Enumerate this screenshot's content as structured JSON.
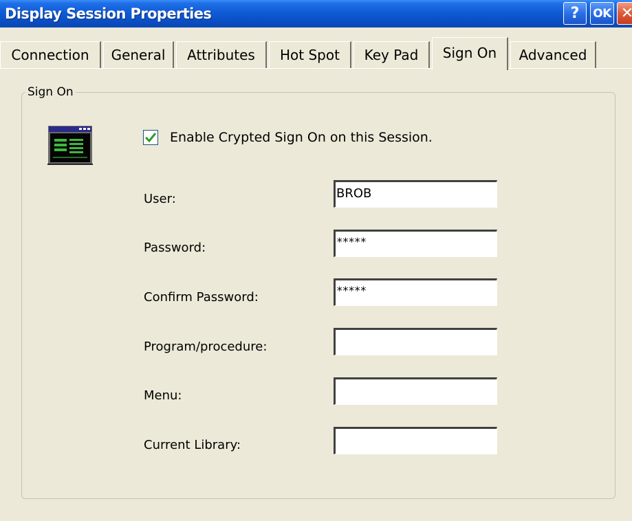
{
  "window": {
    "title": "Display Session Properties",
    "help_label": "?",
    "ok_label": "OK",
    "close_label": "✕"
  },
  "tabs": [
    {
      "label": "Connection",
      "active": false
    },
    {
      "label": "General",
      "active": false
    },
    {
      "label": "Attributes",
      "active": false
    },
    {
      "label": "Hot Spot",
      "active": false
    },
    {
      "label": "Key Pad",
      "active": false
    },
    {
      "label": "Sign On",
      "active": true
    },
    {
      "label": "Advanced",
      "active": false
    }
  ],
  "group": {
    "legend": "Sign On",
    "icon": "terminal-session-icon"
  },
  "enable_signon": {
    "label": "Enable Crypted Sign On on this Session.",
    "checked": true
  },
  "fields": {
    "user": {
      "label": "User:",
      "value": "BROB"
    },
    "password": {
      "label": "Password:",
      "value": "*****"
    },
    "confirm_password": {
      "label": "Confirm Password:",
      "value": "*****"
    },
    "program": {
      "label": "Program/procedure:",
      "value": ""
    },
    "menu": {
      "label": "Menu:",
      "value": ""
    },
    "library": {
      "label": "Current Library:",
      "value": ""
    }
  },
  "colors": {
    "titlebar": "#0a4fc6",
    "dialog_bg": "#ece9d8",
    "check_green": "#2e9a2e",
    "close_red": "#de5b3a"
  }
}
